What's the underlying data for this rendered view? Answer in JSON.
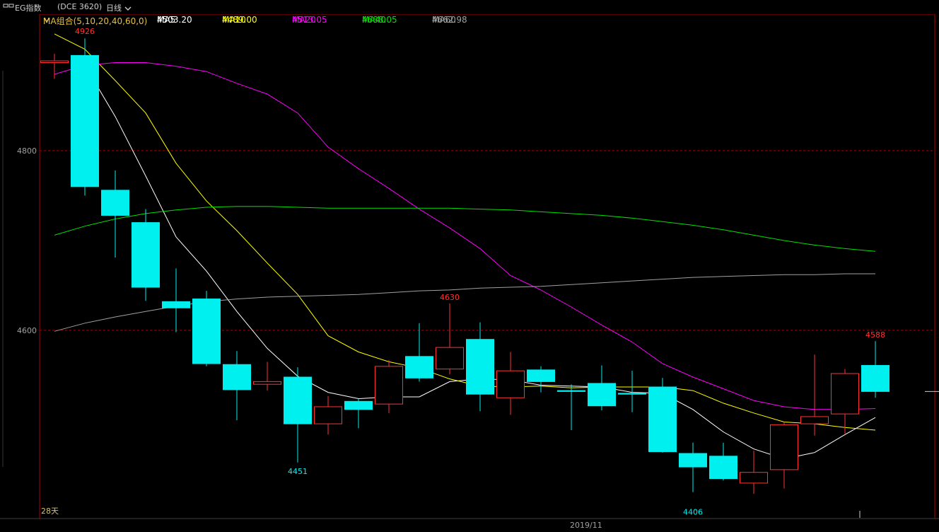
{
  "header": {
    "icon": "window-restore-icon",
    "title": "EG指数",
    "code": "(DCE 3620)",
    "period": "日线",
    "period_icon": "chevron-down-icon"
  },
  "legend": {
    "group_label": "MA组合(5,10,20,40,60,0)",
    "group_icon": "chevron-down-icon",
    "items": [
      {
        "name": "MA5",
        "value": "4503.20",
        "color": "#ffffff"
      },
      {
        "name": "MA10",
        "value": "4489.00",
        "color": "#ffff00"
      },
      {
        "name": "MA20",
        "value": "4513.05",
        "color": "#ff00ff"
      },
      {
        "name": "MA40",
        "value": "4688.05",
        "color": "#00e000"
      },
      {
        "name": "MA60",
        "value": "4662.98",
        "color": "#a0a0a0"
      }
    ]
  },
  "footer": {
    "days_label": "28天",
    "date_label": "2019/11"
  },
  "colors": {
    "up": "#ff3232",
    "down": "#00f0f0",
    "grid": "#b00000",
    "axis": "#b00000",
    "marker_high": "#ff3232",
    "marker_low": "#00f0f0"
  },
  "chart_data": {
    "type": "candlestick",
    "title": "",
    "ylim": [
      4400,
      4930
    ],
    "yticks": [
      4600,
      4800
    ],
    "annotations": [
      {
        "index": 1,
        "value": 4926,
        "label": "4926",
        "kind": "high"
      },
      {
        "index": 8,
        "value": 4451,
        "label": "4451",
        "kind": "low"
      },
      {
        "index": 13,
        "value": 4630,
        "label": "4630",
        "kind": "high"
      },
      {
        "index": 21,
        "value": 4406,
        "label": "4406",
        "kind": "low"
      },
      {
        "index": 27,
        "value": 4588,
        "label": "4588",
        "kind": "high"
      }
    ],
    "candles": [
      {
        "o": 4898,
        "h": 4908,
        "l": 4880,
        "c": 4900
      },
      {
        "o": 4906,
        "h": 4925,
        "l": 4750,
        "c": 4760
      },
      {
        "o": 4756,
        "h": 4778,
        "l": 4681,
        "c": 4728
      },
      {
        "o": 4720,
        "h": 4735,
        "l": 4633,
        "c": 4648
      },
      {
        "o": 4632,
        "h": 4669,
        "l": 4598,
        "c": 4625
      },
      {
        "o": 4635,
        "h": 4644,
        "l": 4560,
        "c": 4563
      },
      {
        "o": 4562,
        "h": 4577,
        "l": 4500,
        "c": 4534
      },
      {
        "o": 4540,
        "h": 4565,
        "l": 4533,
        "c": 4543
      },
      {
        "o": 4548,
        "h": 4559,
        "l": 4453,
        "c": 4496
      },
      {
        "o": 4496,
        "h": 4527,
        "l": 4484,
        "c": 4515
      },
      {
        "o": 4521,
        "h": 4524,
        "l": 4491,
        "c": 4512
      },
      {
        "o": 4518,
        "h": 4567,
        "l": 4508,
        "c": 4560
      },
      {
        "o": 4571,
        "h": 4608,
        "l": 4543,
        "c": 4547
      },
      {
        "o": 4557,
        "h": 4630,
        "l": 4551,
        "c": 4581
      },
      {
        "o": 4590,
        "h": 4609,
        "l": 4510,
        "c": 4529
      },
      {
        "o": 4525,
        "h": 4576,
        "l": 4506,
        "c": 4555
      },
      {
        "o": 4556,
        "h": 4560,
        "l": 4531,
        "c": 4543
      },
      {
        "o": 4533,
        "h": 4540,
        "l": 4489,
        "c": 4532
      },
      {
        "o": 4541,
        "h": 4561,
        "l": 4511,
        "c": 4516
      },
      {
        "o": 4530,
        "h": 4555,
        "l": 4509,
        "c": 4529
      },
      {
        "o": 4537,
        "h": 4547,
        "l": 4464,
        "c": 4465
      },
      {
        "o": 4463,
        "h": 4475,
        "l": 4420,
        "c": 4448
      },
      {
        "o": 4460,
        "h": 4475,
        "l": 4433,
        "c": 4435
      },
      {
        "o": 4430,
        "h": 4466,
        "l": 4418,
        "c": 4442
      },
      {
        "o": 4445,
        "h": 4498,
        "l": 4424,
        "c": 4495
      },
      {
        "o": 4496,
        "h": 4573,
        "l": 4483,
        "c": 4504
      },
      {
        "o": 4507,
        "h": 4557,
        "l": 4485,
        "c": 4552
      },
      {
        "o": 4561,
        "h": 4588,
        "l": 4525,
        "c": 4532
      }
    ],
    "series": [
      {
        "name": "MA5",
        "color": "#ffffff",
        "values": [
          null,
          4895,
          4838,
          4772,
          4704,
          4666,
          4621,
          4580,
          4549,
          4531,
          4524,
          4526,
          4526,
          4543,
          4546,
          4545,
          4539,
          4538,
          4537,
          4531,
          4530,
          4512,
          4487,
          4468,
          4457,
          4464,
          4484,
          4503
        ]
      },
      {
        "name": "MA10",
        "color": "#ffff00",
        "values": [
          4930,
          4913,
          4878,
          4842,
          4786,
          4744,
          4711,
          4675,
          4640,
          4594,
          4576,
          4565,
          4558,
          4546,
          4538,
          4537,
          4538,
          4536,
          4537,
          4537,
          4537,
          4533,
          4519,
          4508,
          4498,
          4496,
          4492,
          4489
        ]
      },
      {
        "name": "MA20",
        "color": "#ff00ff",
        "values": [
          4885,
          4895,
          4898,
          4898,
          4894,
          4888,
          4875,
          4863,
          4842,
          4804,
          4780,
          4758,
          4735,
          4714,
          4691,
          4661,
          4645,
          4626,
          4606,
          4587,
          4563,
          4548,
          4535,
          4522,
          4515,
          4512,
          4512,
          4513
        ]
      },
      {
        "name": "MA40",
        "color": "#00e000",
        "values": [
          4706,
          4716,
          4724,
          4730,
          4734,
          4737,
          4738,
          4738,
          4737,
          4736,
          4736,
          4736,
          4736,
          4736,
          4735,
          4734,
          4732,
          4730,
          4728,
          4725,
          4721,
          4717,
          4712,
          4706,
          4700,
          4695,
          4691,
          4688
        ]
      },
      {
        "name": "MA60",
        "color": "#a0a0a0",
        "values": [
          4599,
          4608,
          4615,
          4621,
          4627,
          4632,
          4635,
          4637,
          4638,
          4639,
          4640,
          4642,
          4644,
          4645,
          4647,
          4648,
          4649,
          4651,
          4653,
          4655,
          4657,
          4659,
          4660,
          4661,
          4662,
          4662,
          4663,
          4663
        ]
      }
    ],
    "last_price": 4532
  }
}
